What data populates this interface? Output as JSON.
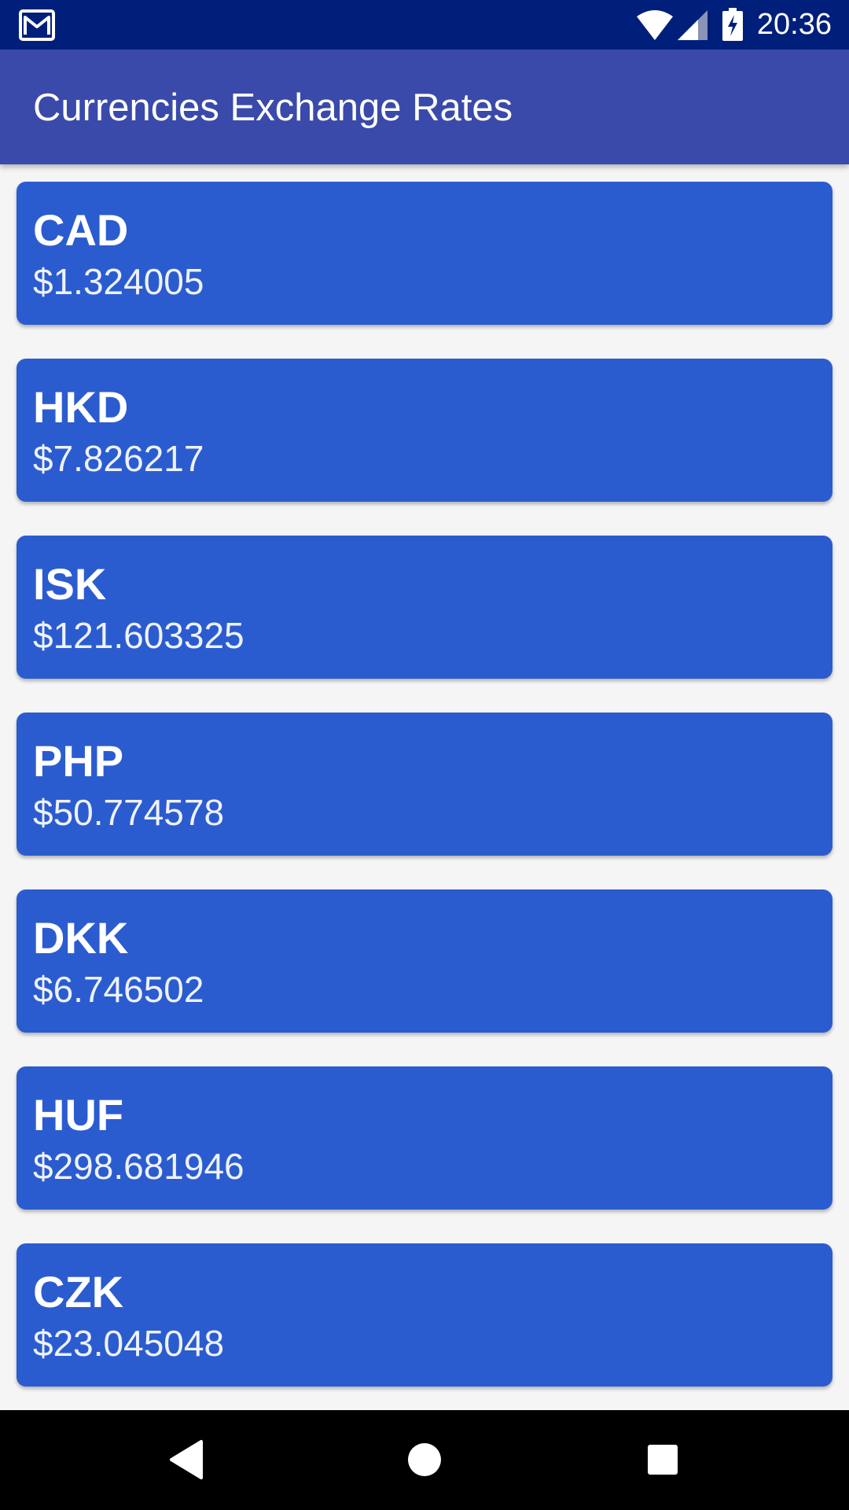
{
  "status_bar": {
    "time": "20:36",
    "icons": [
      "gmail-icon",
      "wifi-icon",
      "cell-signal-icon",
      "battery-charging-icon"
    ]
  },
  "app_bar": {
    "title": "Currencies Exchange Rates"
  },
  "currencies": [
    {
      "code": "CAD",
      "rate": "$1.324005"
    },
    {
      "code": "HKD",
      "rate": "$7.826217"
    },
    {
      "code": "ISK",
      "rate": "$121.603325"
    },
    {
      "code": "PHP",
      "rate": "$50.774578"
    },
    {
      "code": "DKK",
      "rate": "$6.746502"
    },
    {
      "code": "HUF",
      "rate": "$298.681946"
    },
    {
      "code": "CZK",
      "rate": "$23.045048"
    }
  ],
  "nav_bar": {
    "buttons": [
      "back-icon",
      "home-icon",
      "recents-icon"
    ]
  },
  "colors": {
    "status_bar": "#001f7a",
    "app_bar": "#3a4aaa",
    "card": "#2b5ccf",
    "background": "#f5f5f5"
  }
}
